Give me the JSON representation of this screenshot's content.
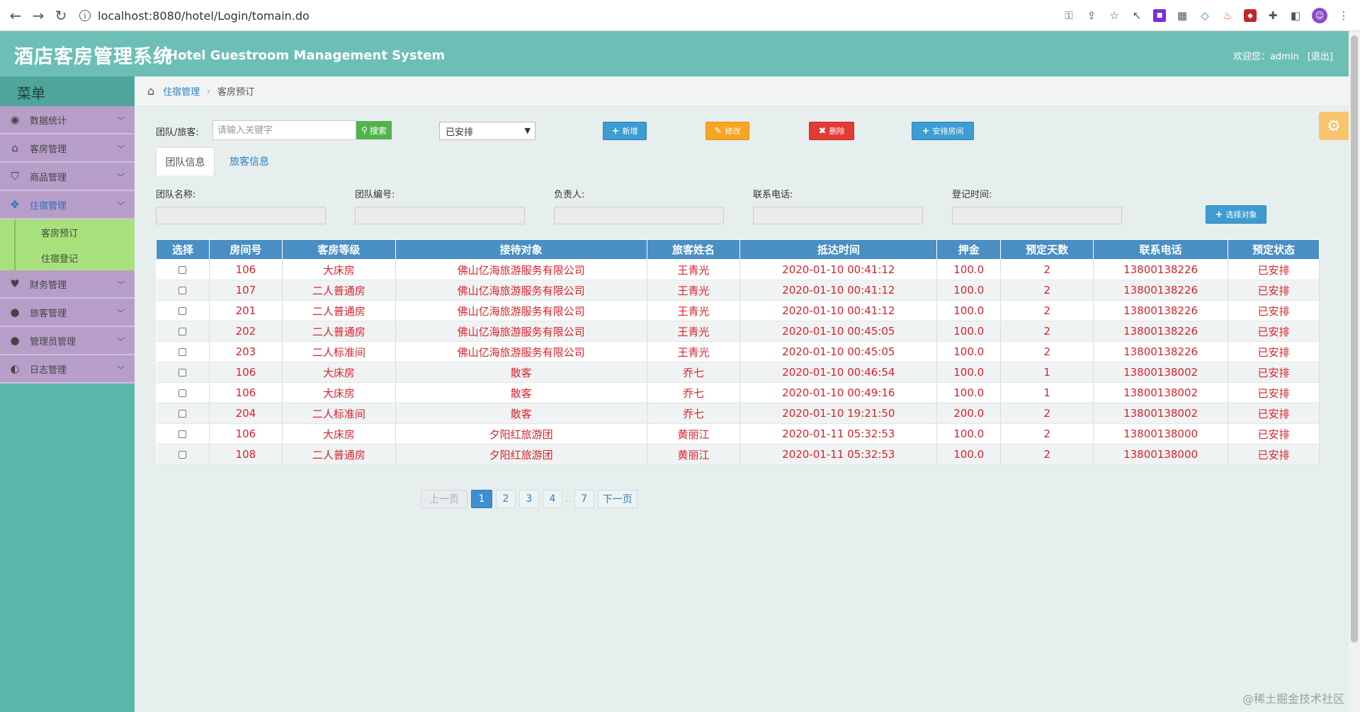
{
  "browser": {
    "url": "localhost:8080/hotel/Login/tomain.do",
    "nav_back": "←",
    "nav_forward": "→",
    "nav_reload": "↻"
  },
  "header": {
    "title_cn": "酒店客房管理系统",
    "title_en": "Hotel Guestroom Management System",
    "welcome": "欢迎您：admin",
    "logout": "[退出]"
  },
  "sidebar": {
    "menu_title": "菜单",
    "items": [
      {
        "label": "数据统计",
        "icon": "dashboard-icon"
      },
      {
        "label": "客房管理",
        "icon": "home-icon"
      },
      {
        "label": "商品管理",
        "icon": "shield-icon"
      },
      {
        "label": "住宿管理",
        "icon": "move-icon"
      },
      {
        "label": "财务管理",
        "icon": "heart-icon"
      },
      {
        "label": "旅客管理",
        "icon": "user-icon"
      },
      {
        "label": "管理员管理",
        "icon": "user-icon"
      },
      {
        "label": "日志管理",
        "icon": "adjust-icon"
      }
    ],
    "sub_items": [
      "客房预订",
      "住宿登记"
    ]
  },
  "breadcrumb": {
    "parent": "住宿管理",
    "current": "客房预订"
  },
  "toolbar": {
    "search_label": "团队/旅客:",
    "search_placeholder": "请输入关键字",
    "search_button": "搜索",
    "status_select": "已安排",
    "add_button": "新增",
    "edit_button": "修改",
    "delete_button": "删除",
    "arrange_button": "安排房间"
  },
  "tabs": {
    "team": "团队信息",
    "guest": "旅客信息"
  },
  "fields": {
    "team_name": "团队名称:",
    "team_code": "团队编号:",
    "leader": "负责人:",
    "phone": "联系电话:",
    "reg_time": "登记时间:",
    "select_button": "选择对象"
  },
  "table": {
    "headers": [
      "选择",
      "房间号",
      "客房等级",
      "接待对象",
      "旅客姓名",
      "抵达时间",
      "押金",
      "预定天数",
      "联系电话",
      "预定状态"
    ],
    "rows": [
      [
        "106",
        "大床房",
        "佛山亿海旅游服务有限公司",
        "王青光",
        "2020-01-10 00:41:12",
        "100.0",
        "2",
        "13800138226",
        "已安排"
      ],
      [
        "107",
        "二人普通房",
        "佛山亿海旅游服务有限公司",
        "王青光",
        "2020-01-10 00:41:12",
        "100.0",
        "2",
        "13800138226",
        "已安排"
      ],
      [
        "201",
        "二人普通房",
        "佛山亿海旅游服务有限公司",
        "王青光",
        "2020-01-10 00:41:12",
        "100.0",
        "2",
        "13800138226",
        "已安排"
      ],
      [
        "202",
        "二人普通房",
        "佛山亿海旅游服务有限公司",
        "王青光",
        "2020-01-10 00:45:05",
        "100.0",
        "2",
        "13800138226",
        "已安排"
      ],
      [
        "203",
        "二人标准间",
        "佛山亿海旅游服务有限公司",
        "王青光",
        "2020-01-10 00:45:05",
        "100.0",
        "2",
        "13800138226",
        "已安排"
      ],
      [
        "106",
        "大床房",
        "散客",
        "乔七",
        "2020-01-10 00:46:54",
        "100.0",
        "1",
        "13800138002",
        "已安排"
      ],
      [
        "106",
        "大床房",
        "散客",
        "乔七",
        "2020-01-10 00:49:16",
        "100.0",
        "1",
        "13800138002",
        "已安排"
      ],
      [
        "204",
        "二人标准间",
        "散客",
        "乔七",
        "2020-01-10 19:21:50",
        "200.0",
        "2",
        "13800138002",
        "已安排"
      ],
      [
        "106",
        "大床房",
        "夕阳红旅游团",
        "黄丽江",
        "2020-01-11 05:32:53",
        "100.0",
        "2",
        "13800138000",
        "已安排"
      ],
      [
        "108",
        "二人普通房",
        "夕阳红旅游团",
        "黄丽江",
        "2020-01-11 05:32:53",
        "100.0",
        "2",
        "13800138000",
        "已安排"
      ]
    ]
  },
  "pagination": {
    "prev": "上一页",
    "pages": [
      "1",
      "2",
      "3",
      "4",
      "7"
    ],
    "ellipsis": "..",
    "next": "下一页",
    "current": "1"
  },
  "watermark": "@稀土掘金技术社区",
  "colors": {
    "header": "#6dbfb6",
    "sidebar_item": "#b79ec9",
    "submenu": "#a8e07e",
    "table_header": "#4a8fc4",
    "row_text": "#d9232d"
  }
}
